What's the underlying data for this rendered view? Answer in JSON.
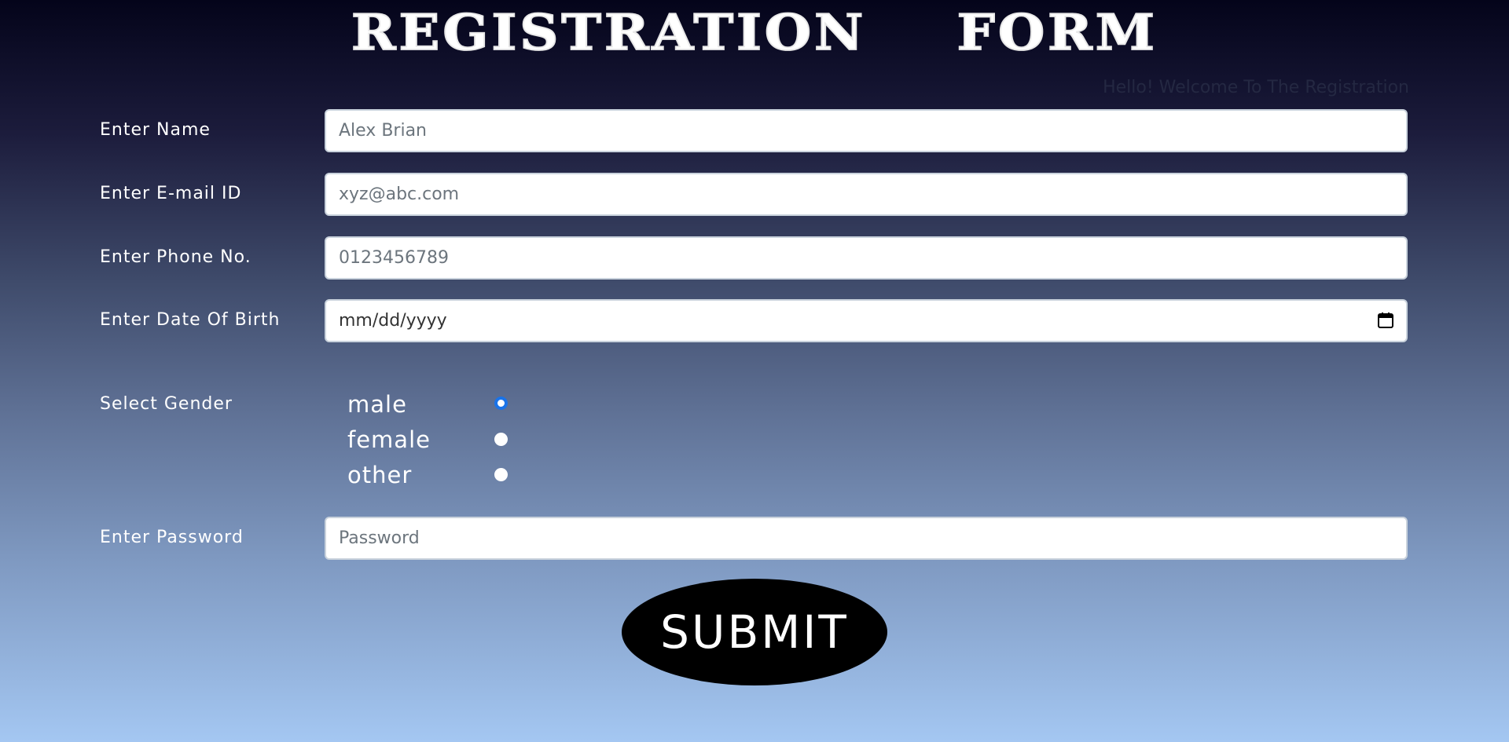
{
  "header": {
    "title": "REGISTRATION  FORM",
    "welcome": "Hello! Welcome To The Registration"
  },
  "form": {
    "name": {
      "label": "Enter Name",
      "placeholder": "Alex Brian"
    },
    "email": {
      "label": "Enter E-mail ID",
      "placeholder": "xyz@abc.com"
    },
    "phone": {
      "label": "Enter Phone No.",
      "placeholder": "0123456789"
    },
    "dob": {
      "label": "Enter Date Of Birth",
      "placeholder": "mm/dd/yyyy"
    },
    "gender": {
      "label": "Select Gender",
      "options": [
        "male",
        "female",
        "other"
      ],
      "selected": "male"
    },
    "password": {
      "label": "Enter Password",
      "placeholder": "Password"
    },
    "submit_label": "SUBMIT"
  },
  "icons": {
    "calendar": "calendar-icon"
  },
  "colors": {
    "radio_accent": "#1a73e8",
    "submit_bg": "#000000"
  }
}
